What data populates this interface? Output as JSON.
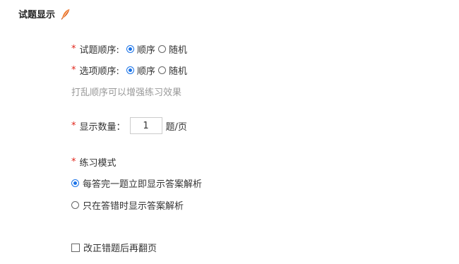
{
  "section": {
    "title": "试题显示",
    "title_icon": "feather-pen-icon"
  },
  "question_order": {
    "required_mark": "*",
    "label": "试题顺序:",
    "options": [
      "顺序",
      "随机"
    ],
    "selected": "顺序"
  },
  "option_order": {
    "required_mark": "*",
    "label": "选项顺序:",
    "options": [
      "顺序",
      "随机"
    ],
    "selected": "顺序"
  },
  "order_hint": "打乱顺序可以增强练习效果",
  "display_count": {
    "required_mark": "*",
    "label": "显示数量：",
    "value": "1",
    "unit": "题/页"
  },
  "practice_mode": {
    "required_mark": "*",
    "label": "练习模式",
    "options": [
      "每答完一题立即显示答案解析",
      "只在答错时显示答案解析"
    ],
    "selected": "每答完一题立即显示答案解析"
  },
  "flip_after_correct": {
    "label": "改正错题后再翻页",
    "checked": false
  },
  "colors": {
    "accent": "#1a73e8",
    "required": "#e1251b",
    "hint": "#999999",
    "icon_orange": "#f07a2a"
  }
}
